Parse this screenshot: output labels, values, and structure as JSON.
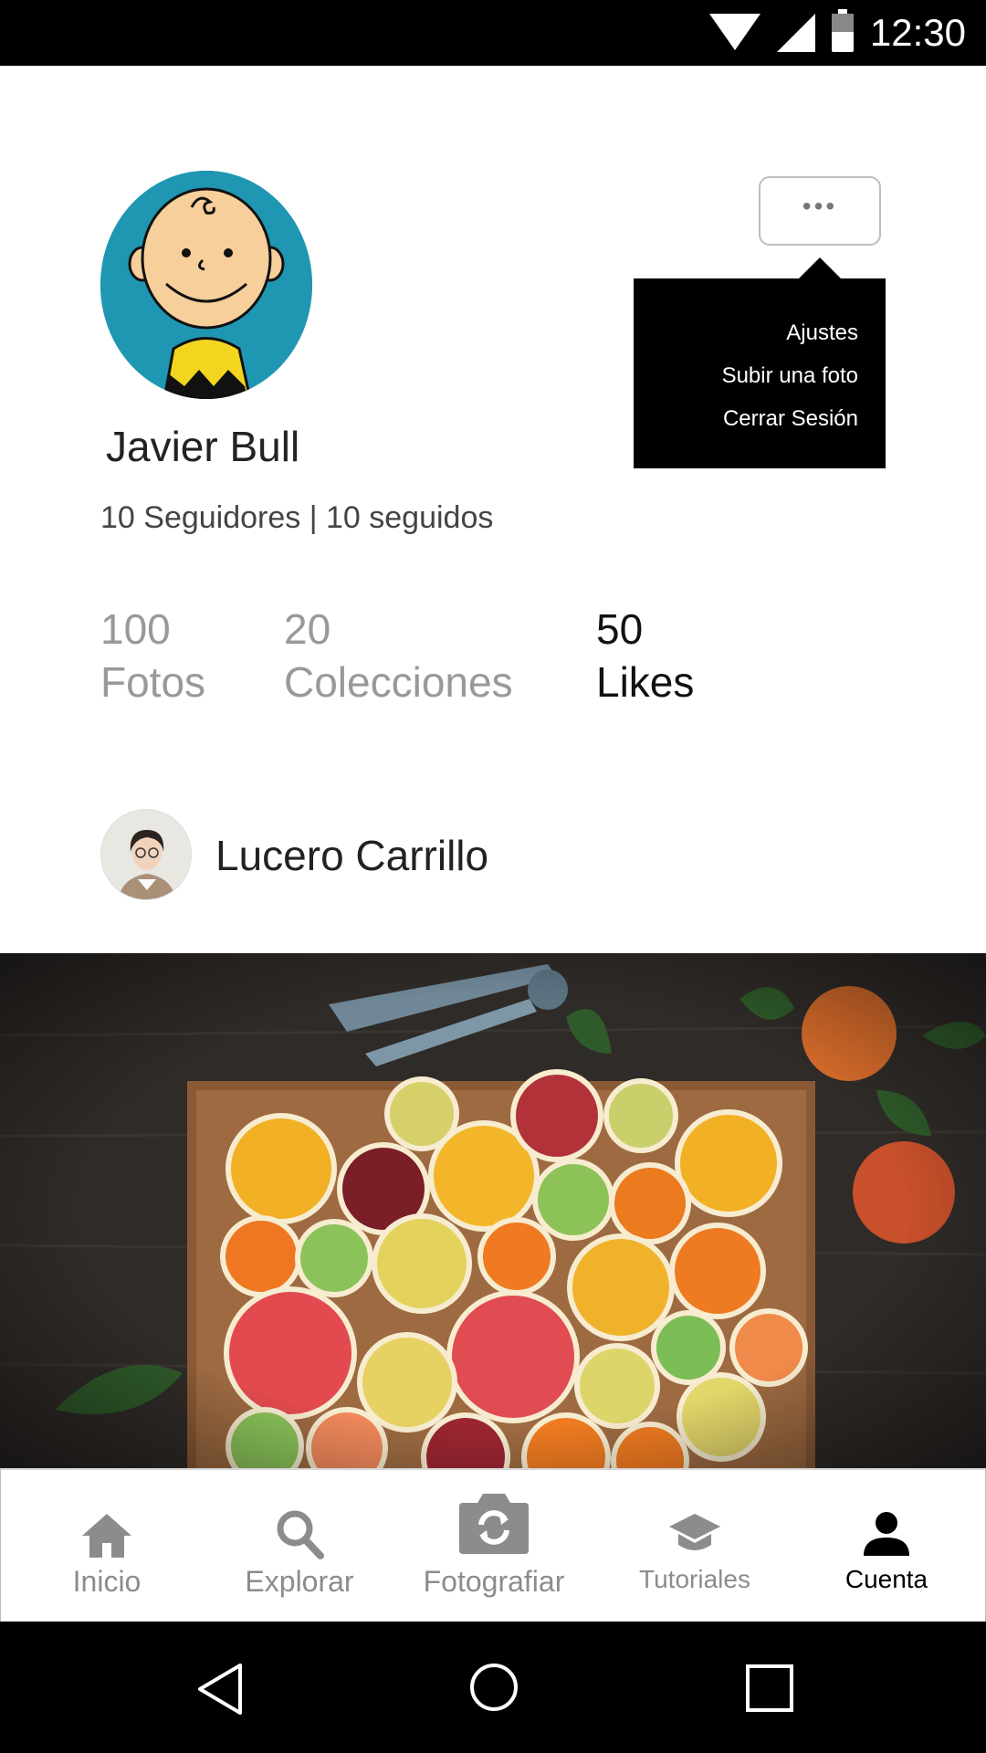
{
  "status_bar": {
    "time": "12:30",
    "icons": [
      "wifi-icon",
      "signal-icon",
      "battery-icon"
    ]
  },
  "profile": {
    "name": "Javier Bull",
    "follow_info": "10 Seguidores | 10 seguidos",
    "stats": [
      {
        "value": "100",
        "label": "Fotos",
        "active": false
      },
      {
        "value": "20",
        "label": "Colecciones",
        "active": false
      },
      {
        "value": "50",
        "label": "Likes",
        "active": true
      }
    ]
  },
  "menu": {
    "button_label": "•••",
    "items": [
      "Ajustes",
      "Subir una foto",
      "Cerrar Sesión"
    ]
  },
  "suggested_user": {
    "name": "Lucero Carrillo"
  },
  "bottom_nav": {
    "items": [
      {
        "label": "Inicio",
        "icon": "home-icon"
      },
      {
        "label": "Explorar",
        "icon": "search-icon"
      },
      {
        "label": "Fotografiar",
        "icon": "camera-icon"
      },
      {
        "label": "Tutoriales",
        "icon": "graduation-cap-icon"
      },
      {
        "label": "Cuenta",
        "icon": "person-icon"
      }
    ],
    "active": "Cuenta"
  },
  "system_nav": [
    "back-icon",
    "home-circle-icon",
    "recents-icon"
  ],
  "colors": {
    "accent_dark": "#000000",
    "inactive": "#8c8c8c",
    "avatar_bg": "#1f97b2"
  }
}
